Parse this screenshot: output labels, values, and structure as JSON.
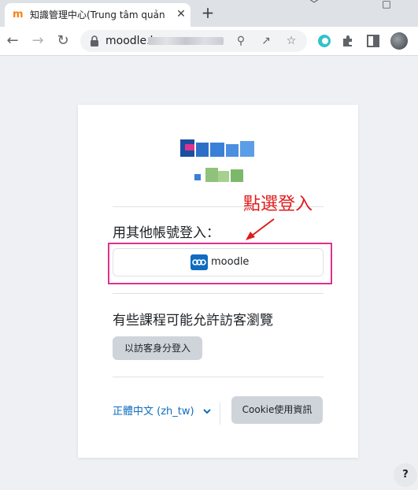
{
  "browser": {
    "tab_title": "知識管理中心(Trung tâm quản lý",
    "tab_favicon": "m",
    "close_glyph": "✕",
    "newtab_glyph": "+",
    "url": "moodle.h",
    "window_controls": {
      "minimize": "﹀",
      "maximize": "□"
    },
    "icons": [
      "back-icon",
      "forward-icon",
      "reload-icon",
      "lock-icon",
      "zoom-icon",
      "share-icon",
      "star-icon",
      "edge-extension-icon",
      "puzzle-icon",
      "sidepanel-icon",
      "profile-avatar"
    ]
  },
  "login": {
    "other_accounts_heading": "用其他帳號登入：",
    "oauth_button_label": "moodle",
    "guest_heading": "有些課程可能允許訪客瀏覽",
    "guest_button_label": "以訪客身分登入",
    "language_label": "正體中文 ‎(zh_tw)‎",
    "cookie_button_label": "Cookie使用資訊"
  },
  "annotation": {
    "text": "點選登入",
    "color": "#e01b1b",
    "highlight_color": "#e0318f"
  },
  "help": {
    "label": "?"
  },
  "colors": {
    "accent": "#0f6cbf",
    "page_bg": "#eef0f4",
    "secondary_button": "#ced4da"
  }
}
